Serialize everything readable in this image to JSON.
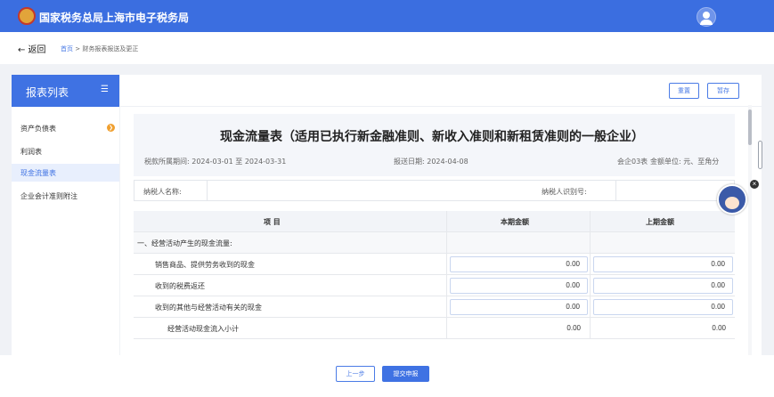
{
  "header": {
    "title": "国家税务总局上海市电子税务局"
  },
  "breadcrumb": {
    "back": "← 返回",
    "home": "首页",
    "sep": " > ",
    "current": "财务报表报送及更正"
  },
  "sidebar": {
    "title": "报表列表",
    "menu_icon": "menu-icon",
    "items": [
      {
        "label": "资产负债表",
        "badge": "❯"
      },
      {
        "label": "利润表"
      },
      {
        "label": "现金流量表"
      },
      {
        "label": "企业会计准则附注"
      }
    ]
  },
  "toolbar": {
    "reset_label": "重置",
    "save_label": "暂存"
  },
  "form": {
    "title": "现金流量表（适用已执行新金融准则、新收入准则和新租赁准则的一般企业）",
    "period": "税款所属期间:  2024-03-01  至  2024-03-31",
    "submit_date": "报送日期:  2024-04-08",
    "form_no": "会企03表",
    "unit": "金额单位:  元、至角分",
    "taxpayer_name_label": "纳税人名称:",
    "taxpayer_id_label": "纳税人识别号:"
  },
  "table": {
    "headers": [
      "项        目",
      "本期金额",
      "上期金额"
    ],
    "rows": [
      {
        "item": "一、经营活动产生的现金流量:",
        "current": "",
        "previous": "",
        "type": "section"
      },
      {
        "item": "销售商品、提供劳务收到的现金",
        "current": "0.00",
        "previous": "0.00",
        "type": "input"
      },
      {
        "item": "收到的税费返还",
        "current": "0.00",
        "previous": "0.00",
        "type": "input"
      },
      {
        "item": "收到的其他与经营活动有关的现金",
        "current": "0.00",
        "previous": "0.00",
        "type": "input"
      },
      {
        "item": "经营活动现金流入小计",
        "current": "0.00",
        "previous": "0.00",
        "type": "subtotal"
      }
    ]
  },
  "footer": {
    "prev_label": "上一步",
    "submit_label": "提交申报"
  },
  "colors": {
    "primary": "#3b6ee0",
    "badge": "#f0a030"
  }
}
